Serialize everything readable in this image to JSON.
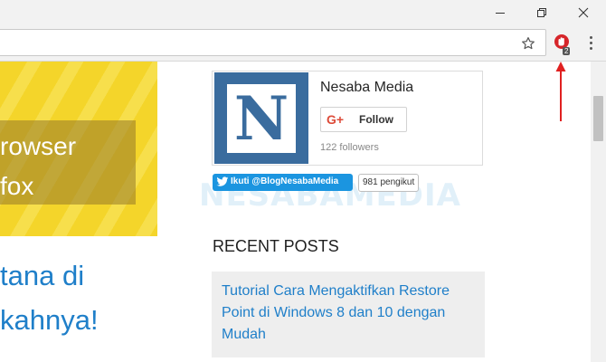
{
  "window": {
    "minimize_icon": "minimize-icon",
    "restore_icon": "restore-icon",
    "close_icon": "close-icon"
  },
  "toolbar": {
    "star_icon": "star-icon",
    "extension_icon": "extension-icon",
    "extension_badge": "2",
    "menu_icon": "more-vertical-icon"
  },
  "hero": {
    "line1": "rowser",
    "line2": "fox",
    "color": "#f4d52a"
  },
  "article": {
    "headline_line1": "tana di",
    "headline_line2": "kahnya!",
    "link_color": "#1f7fc9"
  },
  "gplus": {
    "logo_letter": "N",
    "name": "Nesaba Media",
    "gplus_mark": "G+",
    "follow_label": "Follow",
    "followers": "122 followers"
  },
  "twitter": {
    "label": "Ikuti @BlogNesabaMedia",
    "count": "981 pengikut"
  },
  "watermark": "NESABAMEDIA",
  "sidebar": {
    "recent_title": "RECENT POSTS",
    "posts": [
      {
        "title": "Tutorial Cara Mengaktifkan Restore Point di Windows 8 dan 10 dengan Mudah"
      }
    ]
  },
  "colors": {
    "accent": "#1f7fc9",
    "annotation_arrow": "#e02020"
  }
}
